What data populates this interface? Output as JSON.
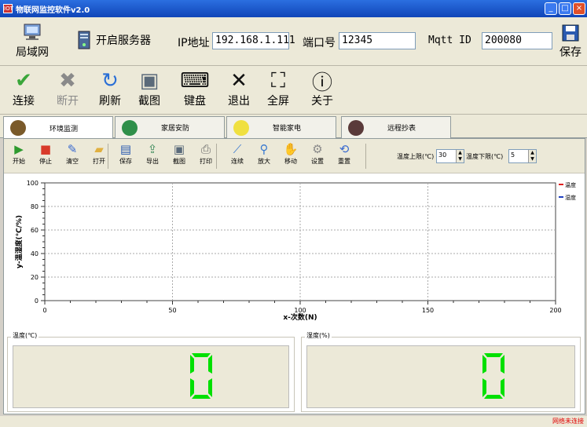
{
  "window": {
    "title": "物联网监控软件v2.0",
    "app_icon": "app-icon",
    "min": "_",
    "max": "□",
    "close": "×"
  },
  "toolbar1": {
    "lan": {
      "label": "局域网",
      "icon": "network-icon"
    },
    "server": {
      "label": "开启服务器",
      "icon": "server-icon"
    },
    "ip_label": "IP地址",
    "ip_value": "192.168.1.111",
    "port_label": "端口号",
    "port_value": "12345",
    "mqtt_label": "Mqtt ID",
    "mqtt_value": "200080",
    "save": {
      "label": "保存",
      "icon": "floppy-icon"
    }
  },
  "toolbar2": [
    {
      "label": "连接",
      "icon": "check-icon",
      "glyph": "✔",
      "color": "#3aa63a",
      "disabled": false
    },
    {
      "label": "断开",
      "icon": "x-icon",
      "glyph": "✖",
      "color": "#8a8a8a",
      "disabled": true
    },
    {
      "label": "刷新",
      "icon": "refresh-icon",
      "glyph": "↻",
      "color": "#2a6fd6",
      "disabled": false
    },
    {
      "label": "截图",
      "icon": "screenshot-icon",
      "glyph": "▣",
      "color": "#5a6a7a",
      "disabled": false
    },
    {
      "label": "键盘",
      "icon": "keyboard-icon",
      "glyph": "⌨",
      "color": "#111111",
      "disabled": false
    },
    {
      "label": "退出",
      "icon": "exit-icon",
      "glyph": "✕",
      "color": "#111111",
      "disabled": false
    },
    {
      "label": "全屏",
      "icon": "fullscreen-icon",
      "glyph": "⛶",
      "color": "#111111",
      "disabled": false
    },
    {
      "label": "关于",
      "icon": "info-icon",
      "glyph": "ⓘ",
      "color": "#111111",
      "disabled": false
    }
  ],
  "tabs": [
    {
      "label": "环境监测",
      "icon": "plant-icon",
      "color": "#7a5a2a",
      "active": true
    },
    {
      "label": "家居安防",
      "icon": "shield-icon",
      "color": "#2f8f4a",
      "active": false
    },
    {
      "label": "智能家电",
      "icon": "bulb-icon",
      "color": "#f0e040",
      "active": false
    },
    {
      "label": "远程抄表",
      "icon": "gauge-icon",
      "color": "#5a3a3a",
      "active": false
    }
  ],
  "chart_toolbar": {
    "buttons": [
      {
        "label": "开始",
        "icon": "play-icon",
        "glyph": "▶",
        "color": "#2e9a2e"
      },
      {
        "label": "停止",
        "icon": "stop-icon",
        "glyph": "■",
        "color": "#d83a2a"
      },
      {
        "label": "清空",
        "icon": "broom-icon",
        "glyph": "✎",
        "color": "#3a6ad0"
      },
      {
        "label": "打开",
        "icon": "folder-open-icon",
        "glyph": "▰",
        "color": "#e0b040"
      },
      {
        "label": "保存",
        "icon": "floppy-icon",
        "glyph": "▤",
        "color": "#2a5ab0"
      },
      {
        "label": "导出",
        "icon": "export-icon",
        "glyph": "⇪",
        "color": "#3a8a5a"
      },
      {
        "label": "截图",
        "icon": "screenshot-icon",
        "glyph": "▣",
        "color": "#5a6a7a"
      },
      {
        "label": "打印",
        "icon": "printer-icon",
        "glyph": "⎙",
        "color": "#6a6a6a"
      },
      {
        "label": "连续",
        "icon": "chart-line-icon",
        "glyph": "⟋",
        "color": "#3a7ad0"
      },
      {
        "label": "放大",
        "icon": "zoom-icon",
        "glyph": "⚲",
        "color": "#3a7ad0"
      },
      {
        "label": "移动",
        "icon": "hand-icon",
        "glyph": "✋",
        "color": "#d0a040"
      },
      {
        "label": "设置",
        "icon": "gear-icon",
        "glyph": "⚙",
        "color": "#8a8a8a"
      },
      {
        "label": "重置",
        "icon": "reset-icon",
        "glyph": "⟲",
        "color": "#3a6ad0"
      }
    ],
    "temp_upper_label": "温度上限(℃)",
    "temp_upper_value": "30",
    "temp_lower_label": "温度下限(℃)",
    "temp_lower_value": "5"
  },
  "chart_data": {
    "type": "line",
    "xlabel": "x-次数(N)",
    "ylabel": "y-温湿度(℃/%)",
    "xlim": [
      0,
      200
    ],
    "ylim": [
      0,
      100
    ],
    "x_ticks": [
      0,
      50,
      100,
      150,
      200
    ],
    "y_ticks": [
      0,
      20,
      40,
      60,
      80,
      100
    ],
    "grid": true,
    "legend_position": "top-right",
    "series": [
      {
        "name": "温度",
        "color": "#e02020",
        "values": []
      },
      {
        "name": "湿度",
        "color": "#2040c0",
        "values": []
      }
    ]
  },
  "readouts": {
    "temperature": {
      "title": "温度(℃)",
      "value": "0",
      "color": "#00e000"
    },
    "humidity": {
      "title": "湿度(%)",
      "value": "0",
      "color": "#00e000"
    }
  },
  "status": {
    "text": "网络未连接"
  }
}
